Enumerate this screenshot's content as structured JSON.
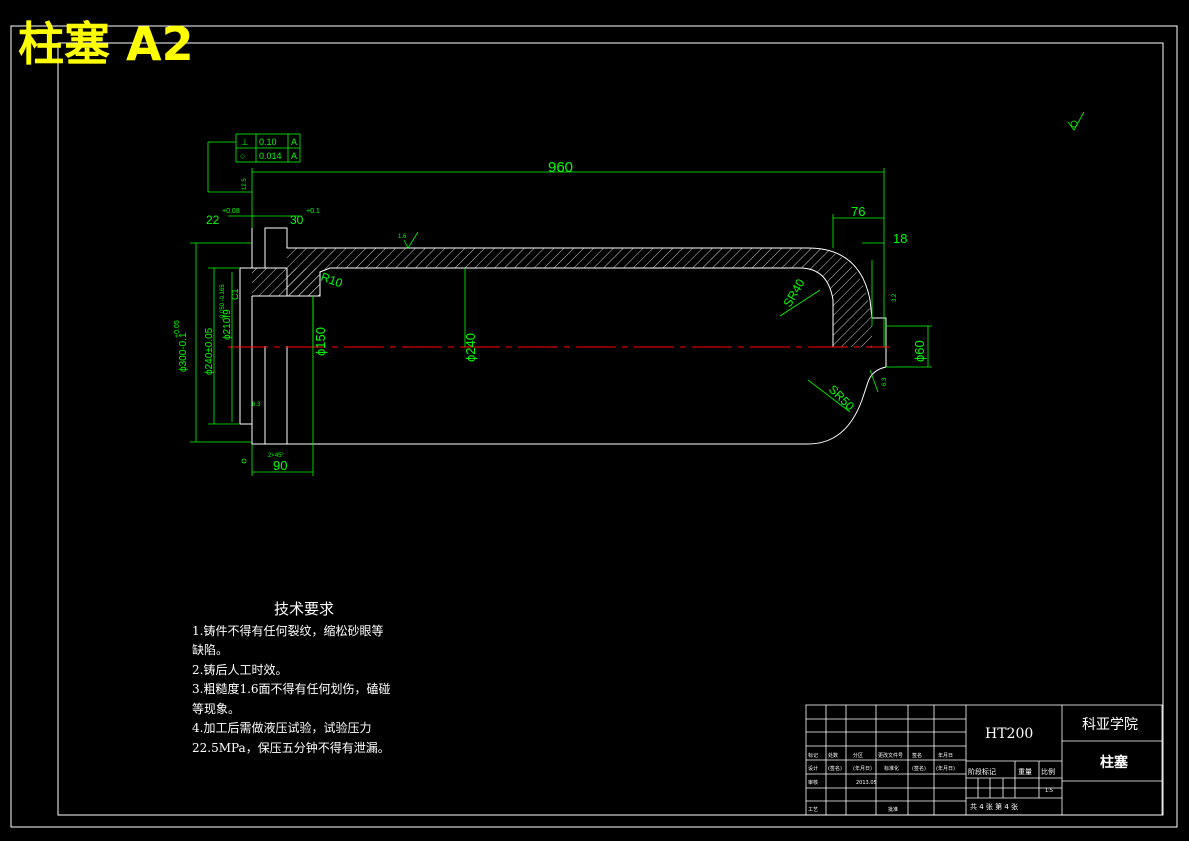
{
  "sheet_title": "柱塞 A2",
  "colors": {
    "background": "#000000",
    "title": "#ffff00",
    "outline": "#ffffff",
    "dimension": "#00ff00",
    "centerline": "#ff0000"
  },
  "dimensions": {
    "overall_length": "960",
    "head_length": "76",
    "head_step": "18",
    "groove_width_a": "22",
    "groove_tol_a": "+0.08",
    "groove_width_b": "30",
    "groove_tol_b": "+0.1",
    "fillet": "R10",
    "sphere_small": "SR40",
    "sphere_large": "SR50",
    "dia_150": "ϕ150",
    "dia_240": "ϕ240",
    "dia_60": "ϕ60",
    "dia_300": "ϕ300-0.1",
    "dia_300_tol": "+0.05",
    "dia_240_tol": "ϕ240±0.05",
    "dia_210": "ϕ210f9",
    "dia_210_tol": "-0.050 -0.165",
    "chamfer": "C1",
    "bottom_len": "90",
    "bottom_note": "2×45°",
    "roughness": "1.6",
    "rough_small_a": "12.5",
    "rough_small_b": "3.2",
    "rough_small_c": "6.3",
    "rough_small_d": "6.3"
  },
  "tolerance_frame": {
    "row1": {
      "symbol": "⊥",
      "value": "0.10",
      "datum": "A"
    },
    "row2": {
      "symbol": "○",
      "value": "0.014",
      "datum": "A"
    }
  },
  "notes": {
    "title": "技术要求",
    "items": [
      "1.铸件不得有任何裂纹，缩松砂眼等",
      "缺陷。",
      "2.铸后人工时效。",
      "3.粗糙度1.6面不得有任何划伤，磕碰",
      "等现象。",
      "4.加工后需做液压试验，试验压力",
      "22.5MPa，保压五分钟不得有泄漏。"
    ]
  },
  "title_block": {
    "material": "HT200",
    "school": "科亚学院",
    "part_name": "柱塞",
    "row_labels": [
      "标记",
      "处数",
      "分区",
      "更改文件号",
      "签名",
      "年月日"
    ],
    "design_labels": [
      "设计",
      "(签名)",
      "(年月日)",
      "标准化",
      "(签名)",
      "(年月日)"
    ],
    "check_labels": [
      "审核",
      "工艺",
      "批准"
    ],
    "stage_headers": [
      "阶段标记",
      "重量",
      "比例"
    ],
    "scale": "1:5",
    "sheet_info": "共 4 张 第 4 张",
    "date": "2013.05"
  }
}
